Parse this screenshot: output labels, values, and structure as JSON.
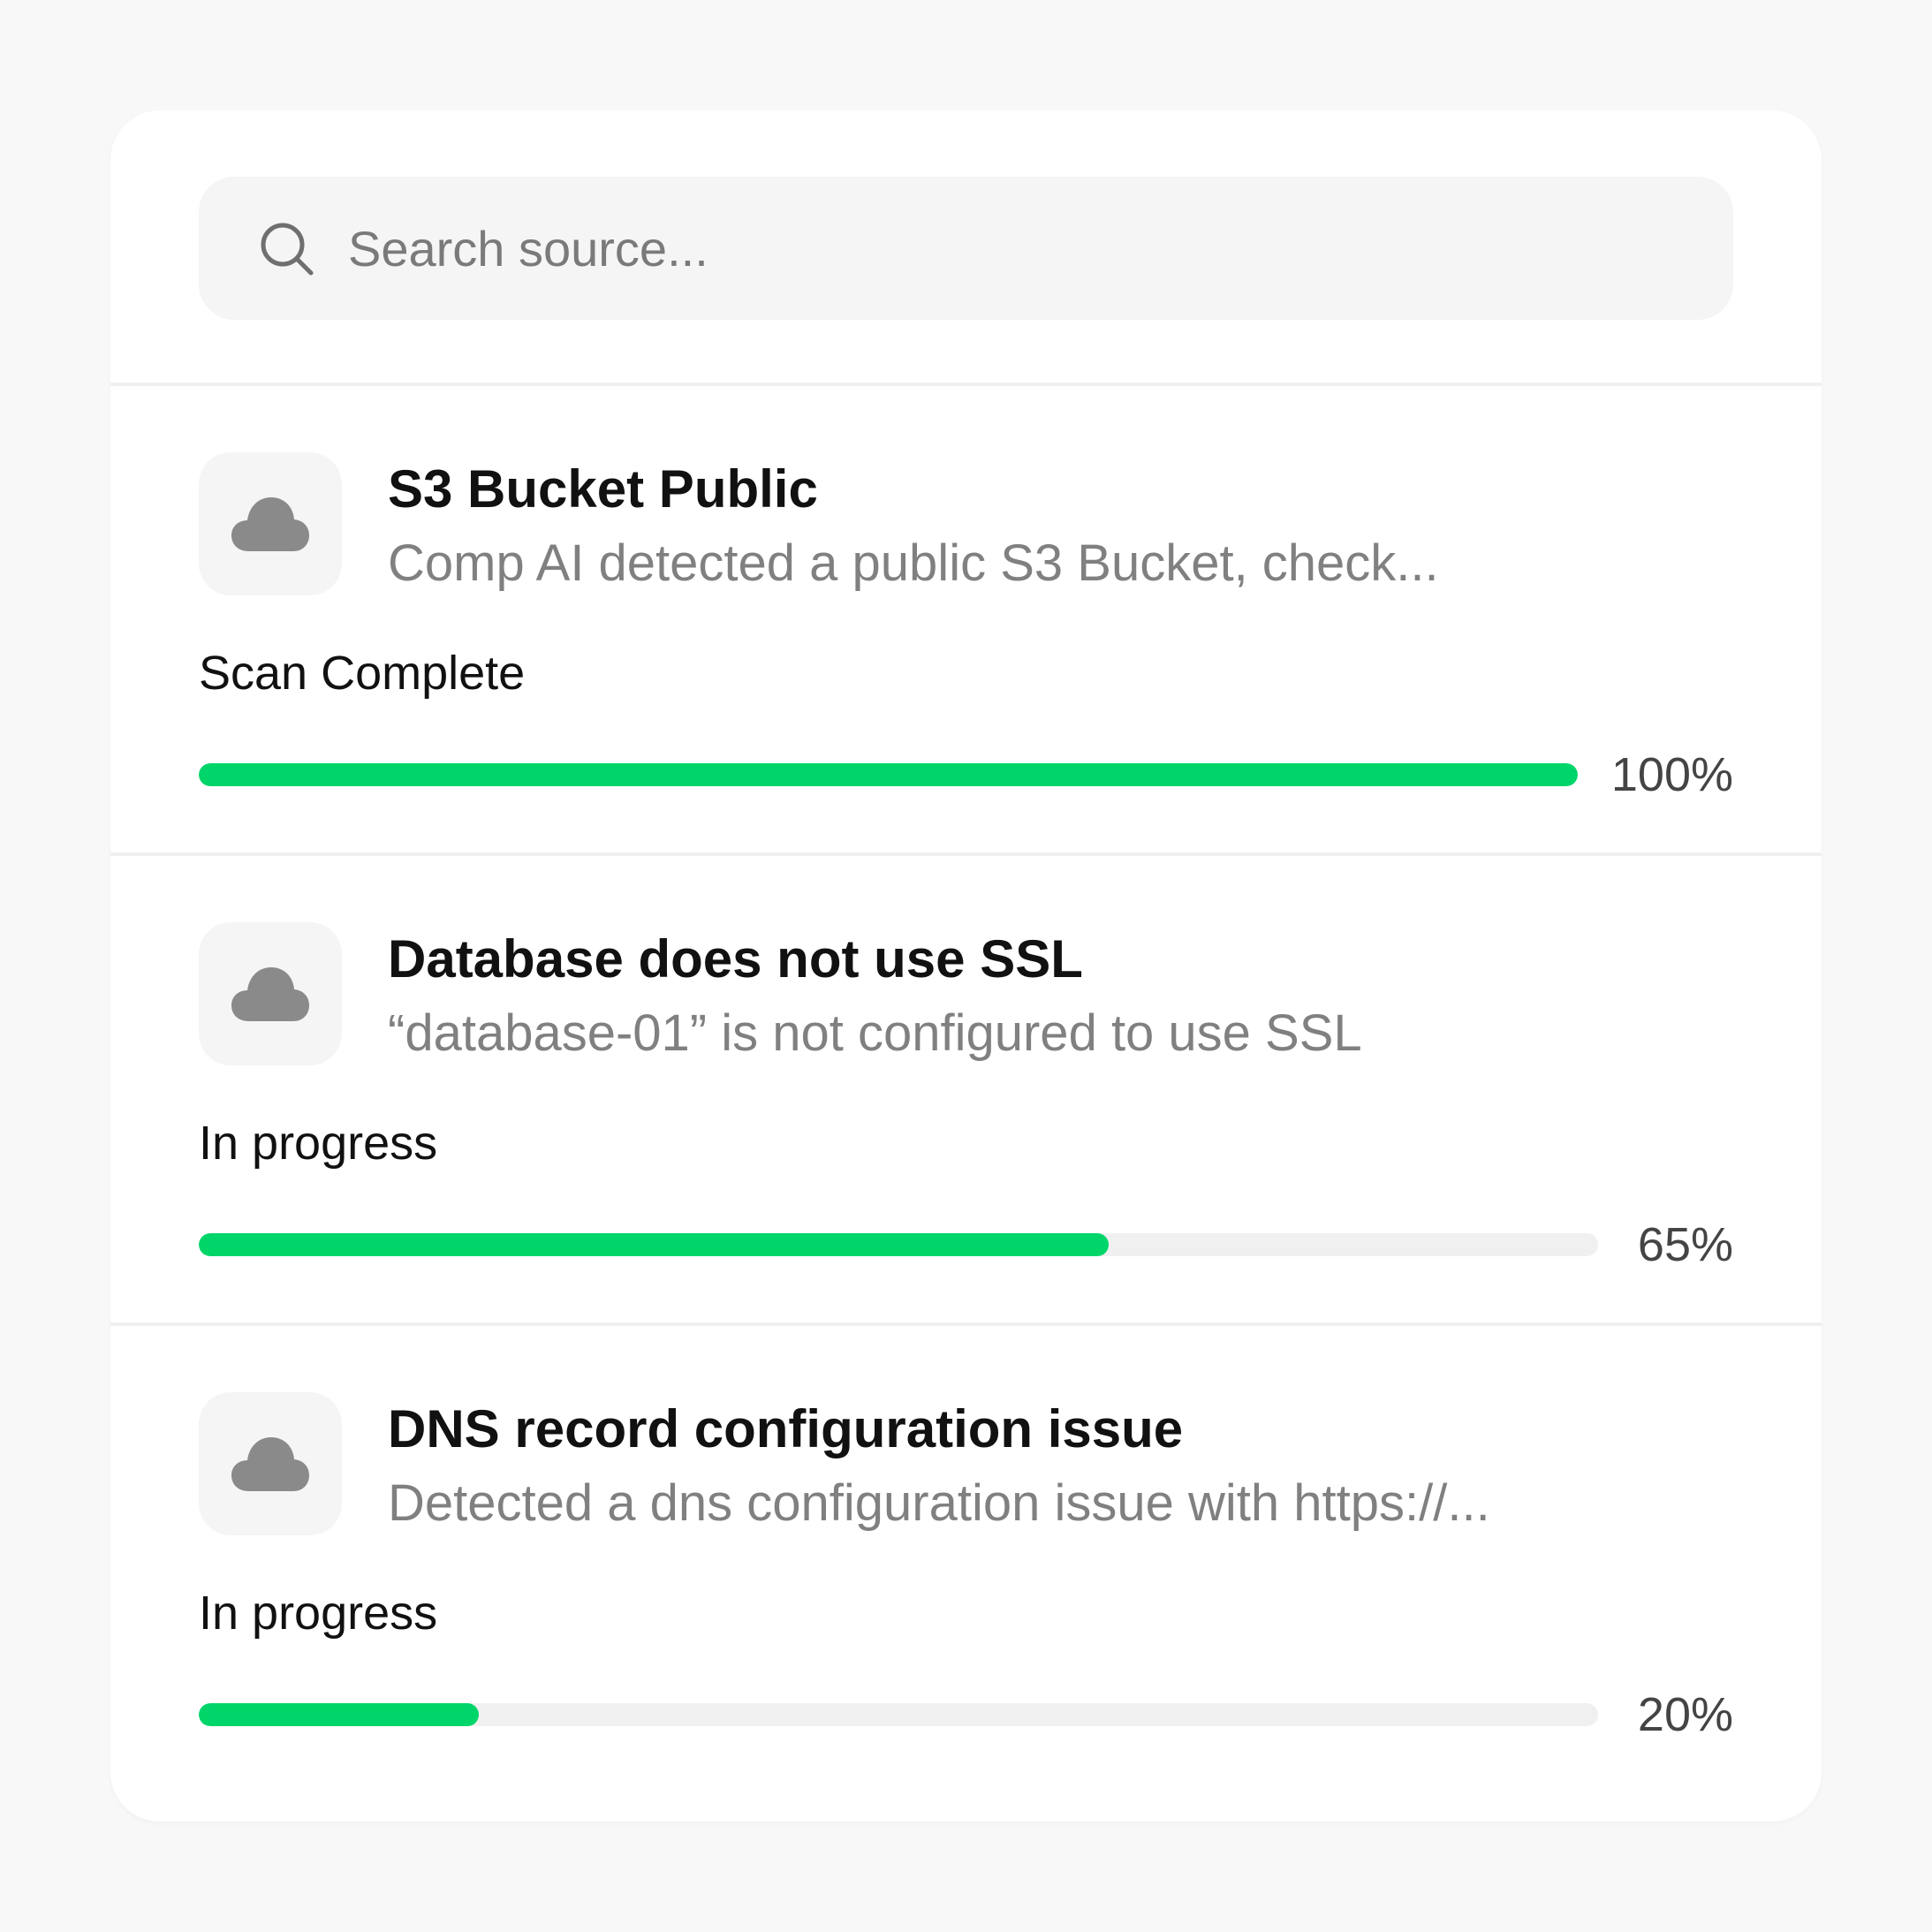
{
  "search": {
    "placeholder": "Search source...",
    "icon": "search-icon"
  },
  "items": [
    {
      "icon": "cloud-icon",
      "title": "S3 Bucket Public",
      "description": "Comp AI detected a public S3 Bucket, check...",
      "status": "Scan Complete",
      "progress": 100,
      "progress_label": "100%"
    },
    {
      "icon": "cloud-icon",
      "title": "Database does not use SSL",
      "description": "“database-01” is not configured to use SSL",
      "status": "In progress",
      "progress": 65,
      "progress_label": "65%"
    },
    {
      "icon": "cloud-icon",
      "title": "DNS record configuration issue",
      "description": "Detected a dns configuration issue with https://...",
      "status": "In progress",
      "progress": 20,
      "progress_label": "20%"
    }
  ],
  "colors": {
    "progress_fill": "#00d56a",
    "progress_track": "#f0f0f0",
    "icon_gray": "#8a8a8a"
  }
}
